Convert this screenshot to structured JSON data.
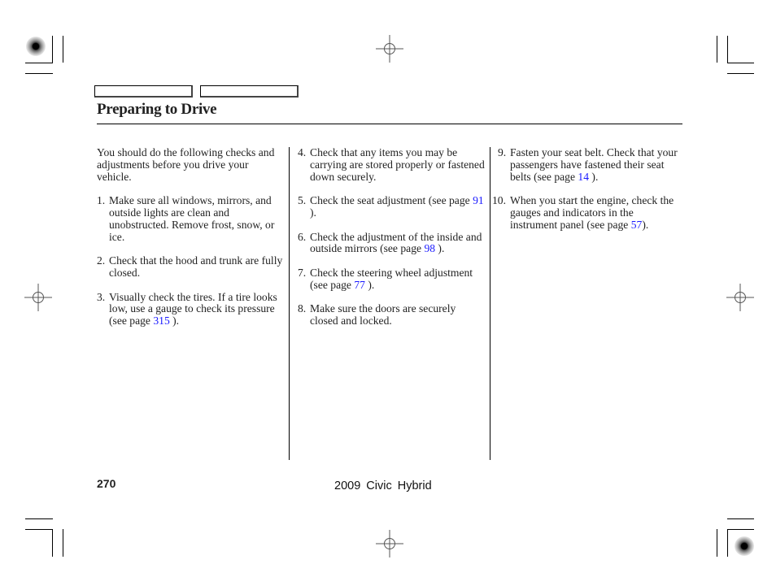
{
  "header": {
    "nav_tabs": [
      {
        "label": ""
      },
      {
        "label": ""
      }
    ],
    "title": "Preparing to Drive"
  },
  "content": {
    "intro": "You should do the following checks and adjustments before you drive your vehicle.",
    "items": [
      {
        "number": "1.",
        "text": "Make sure all windows, mirrors, and outside lights are clean and unobstructed. Remove frost, snow, or ice."
      },
      {
        "number": "2.",
        "text": "Check that the hood and trunk are fully closed."
      },
      {
        "number": "3.",
        "text_before": "Visually check the tires. If a tire looks low, use a gauge to check its pressure (see page ",
        "page_link": "315",
        "text_after": " )."
      },
      {
        "number": "4.",
        "text": "Check that any items you may be carrying are stored properly or fastened down securely."
      },
      {
        "number": "5.",
        "text_before": "Check the seat adjustment (see page ",
        "page_link": "91",
        "text_after": " )."
      },
      {
        "number": "6.",
        "text_before": "Check the adjustment of the inside and outside mirrors (see page ",
        "page_link": "98",
        "text_after": " )."
      },
      {
        "number": "7.",
        "text_before": "Check the steering wheel adjustment (see page ",
        "page_link": "77",
        "text_after": " )."
      },
      {
        "number": "8.",
        "text": "Make sure the doors are securely closed and locked."
      },
      {
        "number": "9.",
        "text_before": "Fasten your seat belt. Check that your passengers have fastened their seat belts (see page ",
        "page_link": "14",
        "text_after": " )."
      },
      {
        "number": "10.",
        "text_before": "When you start the engine, check the gauges and indicators in the instrument panel (see page ",
        "page_link": "57",
        "text_after": ")."
      }
    ]
  },
  "footer": {
    "page_number": "270",
    "book_title": "2009  Civic  Hybrid"
  },
  "colors": {
    "link": "#1a1aff",
    "text": "#222222",
    "rule": "#000000"
  },
  "icons": {
    "crop_marks": "crop-mark",
    "registration": "registration-crosshair",
    "color_target": "color-target"
  }
}
